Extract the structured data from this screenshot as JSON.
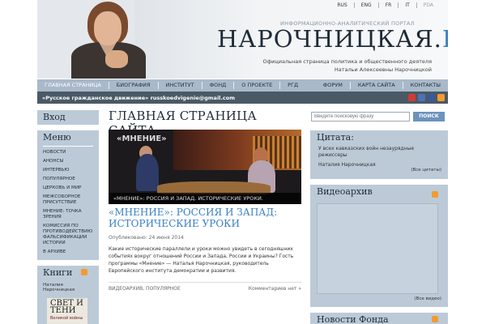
{
  "header": {
    "languages": [
      {
        "label": "RUS",
        "disabled": false
      },
      {
        "label": "ENG",
        "disabled": false
      },
      {
        "label": "FR",
        "disabled": false
      },
      {
        "label": "IT",
        "disabled": false
      },
      {
        "label": "PDA",
        "disabled": true
      }
    ],
    "tagline": "ИНФОРМАЦИОННО-АНАЛИТИЧЕСКИЙ ПОРТАЛ",
    "title_main": "НАРОЧНИЦКАЯ.",
    "title_ru": "РУ",
    "subtitle_line1": "Официальная страница политика и общественного деятеля",
    "subtitle_line2": "Натальи Алексеевны Нарочницкой"
  },
  "nav": {
    "items": [
      "ГЛАВНАЯ СТРАНИЦА",
      "БИОГРАФИЯ",
      "ИНСТИТУТ",
      "ФОНД",
      "О ПРОЕКТЕ",
      "РГД"
    ],
    "right_items": [
      "ФОРУМ",
      "КАРТА САЙТА",
      "КОНТАКТЫ"
    ]
  },
  "band": {
    "text": "«Русское гражданское движение» russkoedvigenie@gmail.com"
  },
  "left": {
    "login_title": "Вход",
    "menu_title": "Меню",
    "menu_items": [
      "НОВОСТИ",
      "АНОНСЫ",
      "ИНТЕРВЬЮ",
      "ПОПУЛЯРНОЕ",
      "ЦЕРКОВЬ И МИР",
      "МЕЖСОБОРНОЕ ПРИСУТСТВИЕ",
      "МНЕНИЕ: ТОЧКА ЗРЕНИЯ",
      "КОМИССИЯ ПО ПРОТИВОДЕЙСТВИЮ ФАЛЬСИФИКАЦИИ ИСТОРИИ",
      "В АРХИВЕ"
    ],
    "books_title": "Книги",
    "books_author": "Наталия Нарочницкая",
    "book_cover_t1": "СВЕТ И ТЕНИ",
    "book_cover_t2": "Великой войны"
  },
  "center": {
    "page_title": "ГЛАВНАЯ СТРАНИЦА САЙТА",
    "photo_logo": "«МНЕНИЕ»",
    "photo_caption": "«МНЕНИЕ»: РОССИЯ И ЗАПАД. ИСТОРИЧЕСКИЕ УРОКИ.",
    "article_title": "«МНЕНИЕ»: РОССИЯ И ЗАПАД: ИСТОРИЧЕСКИЕ УРОКИ",
    "published": "Опубликовано: 24 июня 2014",
    "excerpt": "Какие исторические параллели и уроки можно увидеть в сегодняшних событиях вокруг отношений России и Запада, России и Украины? Гость программы «Мнение» — Наталья Нарочницкая, руководитель Европейского института демократии и развития.",
    "categories": "ВИДЕОАРХИВ, ПОПУЛЯРНОЕ",
    "comments": "Комментариев нет »"
  },
  "right": {
    "search_placeholder": "Введите поисковую фразу",
    "search_button": "ПОИСК",
    "quote_title": "Цитата:",
    "quote_text": "У всех кавказских войн незаурядные режиссеры",
    "quote_author": "Наталия Нарочницкая",
    "quote_all": "(Все цитаты)",
    "video_title": "Видеоархив",
    "video_all": "(Все видео)",
    "news_title": "Новости Фонда"
  },
  "colors": {
    "accent": "#3a7fc4",
    "nav_bg": "#a9b9ca",
    "box_bg": "#bccad8",
    "band_bg": "#4a5966",
    "rss": "#f29b31"
  }
}
